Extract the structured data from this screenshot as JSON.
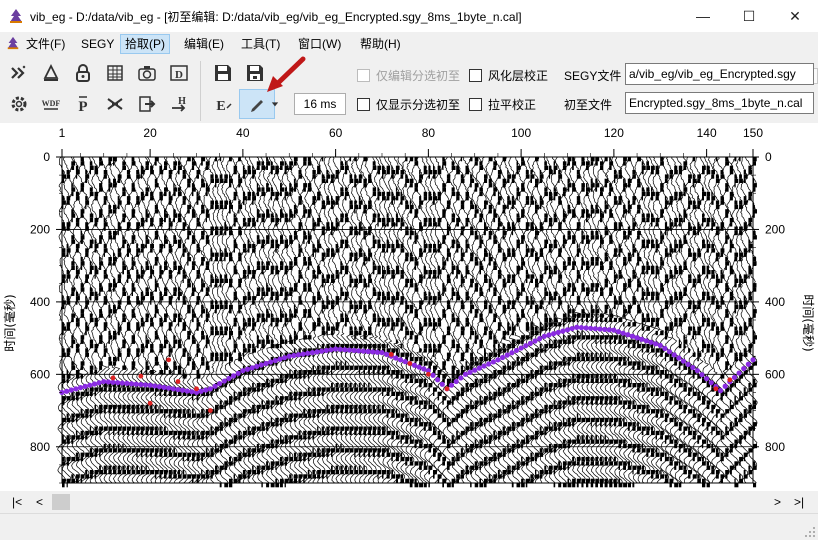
{
  "window": {
    "title": "vib_eg - D:/data/vib_eg - [初至编辑: D:/data/vib_eg/vib_eg_Encrypted.sgy_8ms_1byte_n.cal]",
    "minimize": "—",
    "maximize": "☐",
    "close": "✕"
  },
  "menu": [
    {
      "label": "文件(F)",
      "active": false
    },
    {
      "label": "SEGY",
      "active": false
    },
    {
      "label": "拾取(P)",
      "active": true
    },
    {
      "label": "编辑(E)",
      "active": false
    },
    {
      "label": "工具(T)",
      "active": false
    },
    {
      "label": "窗口(W)",
      "active": false
    },
    {
      "label": "帮助(H)",
      "active": false
    }
  ],
  "toolbar": {
    "interval_value": "16 ms",
    "chk_edit_selected": "仅编辑分选初至",
    "chk_show_selected": "仅显示分选初至",
    "chk_weathering": "风化层校正",
    "chk_flatten": "拉平校正",
    "segy_label": "SEGY文件",
    "segy_value": "a/vib_eg/vib_eg_Encrypted.sgy",
    "firstbreak_label": "初至文件",
    "firstbreak_value": "Encrypted.sgy_8ms_1byte_n.cal",
    "icons": [
      "wand-icon",
      "antenna-icon",
      "lock-icon",
      "table-icon",
      "camera-icon",
      "display-d-icon",
      "save-icon",
      "save-as-icon",
      "settings-icon",
      "wdf-icon",
      "p-icon",
      "crossover-icon",
      "export-icon",
      "h-arrow-icon",
      "edit-e-icon",
      "pencil-icon",
      "dropdown-icon"
    ]
  },
  "plot": {
    "top_ticks": [
      "1",
      "20",
      "40",
      "60",
      "80",
      "100",
      "120",
      "140",
      "150"
    ],
    "left_ticks": [
      "0",
      "200",
      "400",
      "600",
      "800"
    ],
    "right_ticks": [
      "0",
      "200",
      "400",
      "600",
      "800"
    ],
    "y_axis_label": "时间(毫秒)",
    "traces": 150,
    "time_max_ms": 900
  },
  "scroll": {
    "left": "|<",
    "prev": "<",
    "next": ">",
    "right": ">|"
  },
  "colors": {
    "pick_purple": "#8a2be2",
    "pick_red": "#dd2222",
    "accent_selected": "#cce4f7"
  }
}
